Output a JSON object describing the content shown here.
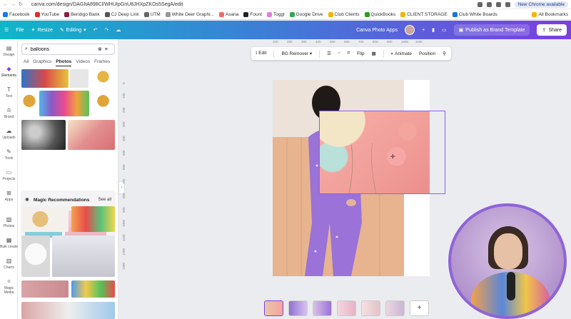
{
  "browser": {
    "url": "canva.com/design/DAGItA898Cl/WHUIpGnU8JHXpZKOs5SegA/edit",
    "update_label": "New Chrome available",
    "bookmarks": [
      "Facebook",
      "YouTube",
      "Bendigo Bank",
      "CJ Deep Link",
      "UTM",
      "White Deer Graphi...",
      "Asana",
      "Fount",
      "Toggl",
      "Google Drive",
      "Club Clients",
      "QuickBooks",
      "CLIENT STORAGE",
      "Club White Boards"
    ],
    "all_bookmarks": "All Bookmarks"
  },
  "toolbar": {
    "file": "File",
    "resize": "Resize",
    "editing": "Editing",
    "app_name": "Canva Photo Apps",
    "publish": "Publish as Brand Template",
    "share": "Share"
  },
  "rail": [
    "Design",
    "Elements",
    "Text",
    "Brand",
    "Uploads",
    "Tools",
    "Projects",
    "Apps",
    "Photos",
    "Bulk create",
    "Charts",
    "Magic Media"
  ],
  "panel": {
    "search_value": "balloons",
    "tabs": [
      "All",
      "Graphics",
      "Photos",
      "Videos",
      "Frames"
    ],
    "magic_title": "Magic Recommendations",
    "see_all": "See all"
  },
  "context_toolbar": {
    "edit": "Edit",
    "bg_remover": "BG Remover",
    "flip": "Flip",
    "animate": "Animate",
    "position": "Position"
  },
  "ruler_h": [
    "100",
    "200",
    "300",
    "400",
    "500",
    "600",
    "700",
    "800",
    "900",
    "1000",
    "1100"
  ],
  "ruler_v": [
    "0",
    "100",
    "200",
    "300",
    "400",
    "500",
    "600",
    "700",
    "800",
    "900",
    "1000",
    "1100",
    "1200",
    "1300"
  ],
  "pages": [
    1,
    2,
    3,
    4,
    5,
    6
  ],
  "colors": {
    "accent": "#7b3fe0",
    "gradient_start": "#0fb6c8",
    "gradient_end": "#7b3fe0"
  }
}
